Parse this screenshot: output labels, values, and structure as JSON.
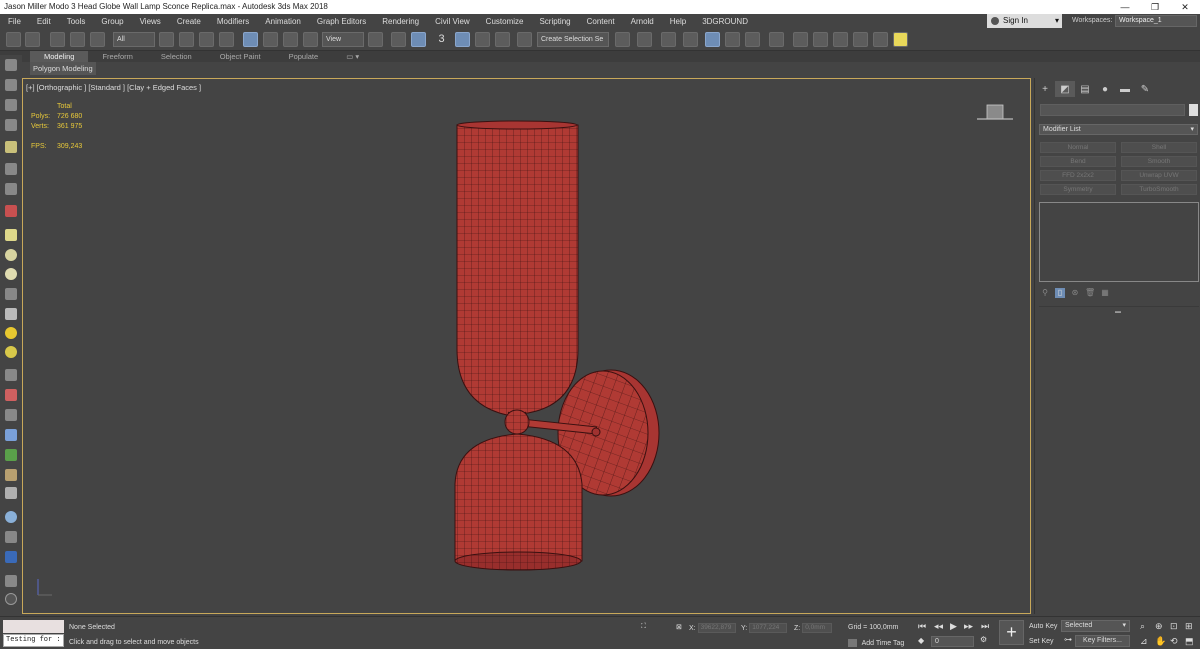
{
  "window": {
    "title": "Jason Miller Modo 3 Head Globe Wall Lamp Sconce Replica.max - Autodesk 3ds Max 2018",
    "controls": [
      "—",
      "❐",
      "✕"
    ]
  },
  "menu": [
    "File",
    "Edit",
    "Tools",
    "Group",
    "Views",
    "Create",
    "Modifiers",
    "Animation",
    "Graph Editors",
    "Rendering",
    "Civil View",
    "Customize",
    "Scripting",
    "Content",
    "Arnold",
    "Help",
    "3DGROUND"
  ],
  "account": {
    "signin_label": "Sign In",
    "workspaces_label": "Workspaces:",
    "workspace_value": "Workspace_1"
  },
  "toolbar": {
    "filter_value": "All",
    "refcoord_value": "View",
    "snap_label": "3",
    "named_selection_value": "Create Selection Se"
  },
  "ribbon": {
    "tabs": [
      "Modeling",
      "Freeform",
      "Selection",
      "Object Paint",
      "Populate"
    ],
    "active_tab": "Modeling",
    "sub_label": "Polygon Modeling"
  },
  "viewport": {
    "label": "[+] [Orthographic ] [Standard ] [Clay + Edged Faces ]",
    "stats": {
      "total_label": "Total",
      "polys_label": "Polys:",
      "polys_value": "726 680",
      "verts_label": "Verts:",
      "verts_value": "361 975",
      "fps_label": "FPS:",
      "fps_value": "309,243"
    },
    "colors": {
      "mesh": "#b03a34",
      "wire": "#3a1010",
      "background": "#444444",
      "border": "#c8a85a"
    }
  },
  "command_panel": {
    "modifier_list_label": "Modifier List",
    "modifier_buttons": [
      "Normal",
      "Shell",
      "Bend",
      "Smooth",
      "FFD 2x2x2",
      "Unwrap UVW",
      "Symmetry",
      "TurboSmooth"
    ]
  },
  "status": {
    "maxscript_value": "Testing for :",
    "selection_text": "None Selected",
    "prompt_text": "Click and drag to select and move objects",
    "x_label": "X:",
    "x_value": "39622,879",
    "y_label": "Y:",
    "y_value": "1077,224",
    "z_label": "Z:",
    "z_value": "0,0mm",
    "grid_text": "Grid = 100,0mm",
    "add_time_tag": "Add Time Tag",
    "frame_value": "0",
    "auto_key": "Auto Key",
    "set_key": "Set Key",
    "selected_value": "Selected",
    "key_filters": "Key Filters..."
  }
}
